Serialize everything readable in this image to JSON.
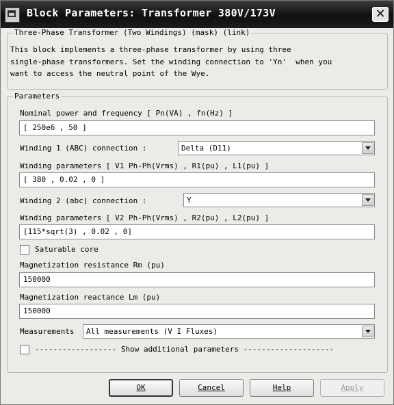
{
  "window": {
    "title": "Block Parameters: Transformer 380V/173V"
  },
  "mask": {
    "legend": "Three-Phase Transformer (Two Windings) (mask) (link)",
    "description": "This block implements a three-phase transformer by using three\nsingle-phase transformers. Set the winding connection to 'Yn'  when you\nwant to access the neutral point of the Wye."
  },
  "params": {
    "legend": "Parameters",
    "nominal_label": "Nominal power and frequency  [ Pn(VA) , fn(Hz) ]",
    "nominal_value": "[ 250e6 , 50 ]",
    "w1_conn_label": "Winding 1 (ABC) connection :",
    "w1_conn_value": "Delta (D11)",
    "w1_params_label": "Winding parameters [ V1 Ph-Ph(Vrms) , R1(pu) , L1(pu) ]",
    "w1_params_value": "[ 380 , 0.02 , 0 ]",
    "w2_conn_label": "Winding 2 (abc) connection :",
    "w2_conn_value": "Y",
    "w2_params_label": "Winding parameters [ V2 Ph-Ph(Vrms) , R2(pu) , L2(pu) ]",
    "w2_params_value": "[115*sqrt(3) , 0.02 , 0]",
    "saturable_label": "Saturable core",
    "saturable_checked": false,
    "rm_label": "Magnetization resistance  Rm (pu)",
    "rm_value": "150000",
    "lm_label": "Magnetization reactance Lm (pu)",
    "lm_value": "150000",
    "measurements_label": "Measurements",
    "measurements_value": "All measurements (V I Fluxes)",
    "show_additional_label": "------------------ Show additional parameters --------------------",
    "show_additional_checked": false
  },
  "buttons": {
    "ok": "OK",
    "cancel": "Cancel",
    "help": "Help",
    "apply": "Apply"
  }
}
